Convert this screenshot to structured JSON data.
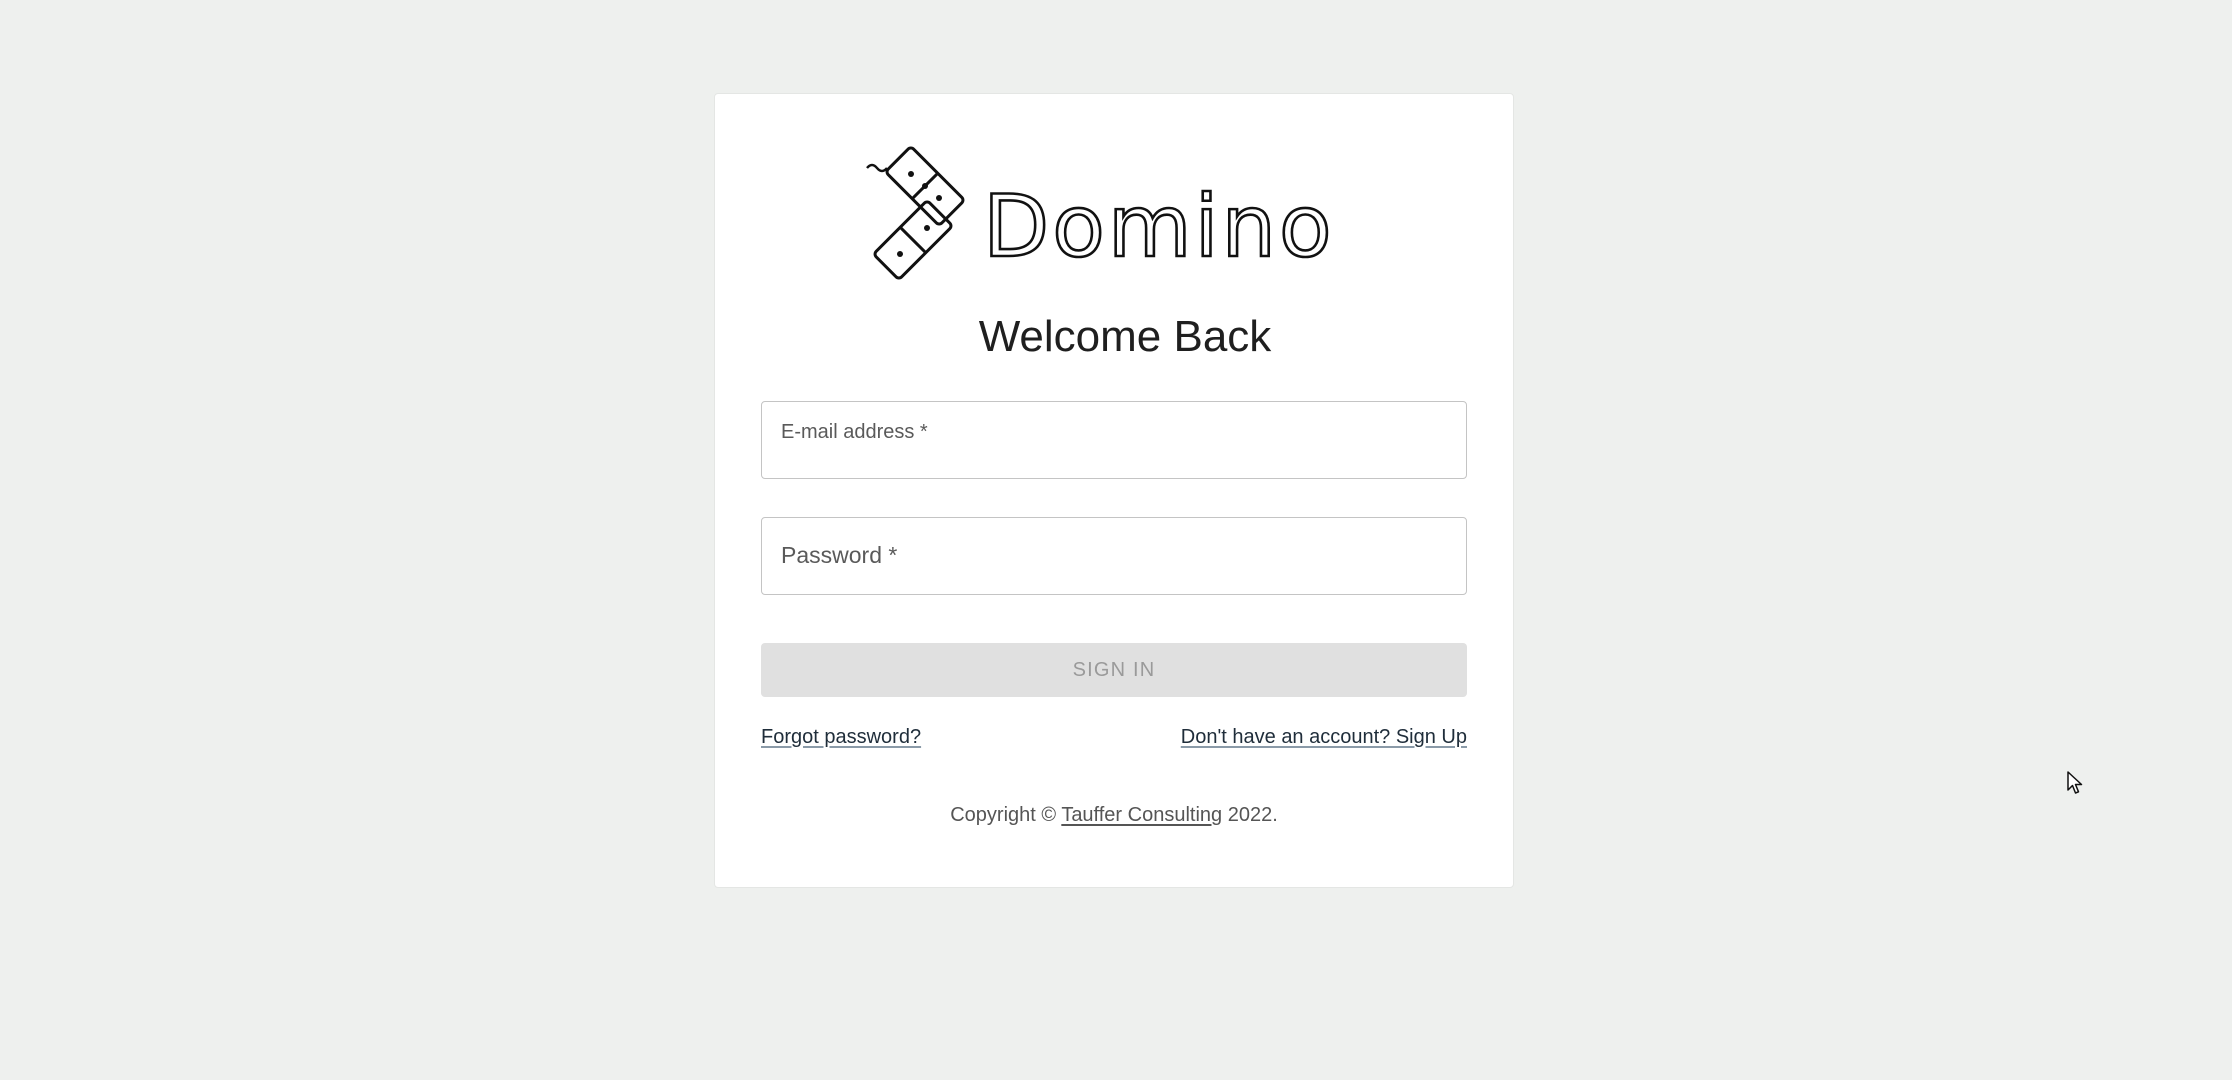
{
  "brand": {
    "name": "Domino"
  },
  "login": {
    "title": "Welcome Back",
    "email_label": "E-mail address *",
    "email_value": "",
    "password_label": "Password *",
    "password_value": "",
    "signin_label": "SIGN IN",
    "forgot_label": "Forgot password?",
    "signup_label": "Don't have an account? Sign Up"
  },
  "footer": {
    "prefix": "Copyright ©",
    "company": "Tauffer Consulting",
    "suffix": "2022."
  },
  "colors": {
    "background": "#eef0ee",
    "card": "#ffffff",
    "button_disabled": "#e0e0e0"
  },
  "icons": {
    "logo": "domino-tiles-icon",
    "cursor": "mouse-pointer-icon"
  }
}
